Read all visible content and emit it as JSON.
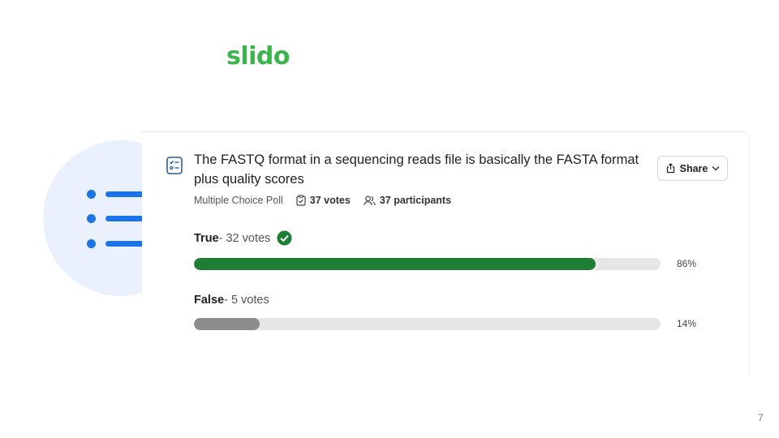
{
  "brand": {
    "logo_text": "slido",
    "color": "#3bb54a"
  },
  "poll": {
    "question": "The FASTQ format in a sequencing reads file is basically the FASTA format plus quality scores",
    "type_label": "Multiple Choice Poll",
    "votes_label": "37 votes",
    "participants_label": "37 participants",
    "share_label": "Share",
    "options": [
      {
        "name": "True",
        "votes_text": " - 32 votes",
        "percent": 86,
        "percent_label": "86%",
        "correct": true,
        "color": "#1e7e34"
      },
      {
        "name": "False",
        "votes_text": " - 5 votes",
        "percent": 14,
        "percent_label": "14%",
        "correct": false,
        "color": "#8c8c8c"
      }
    ]
  },
  "slide": {
    "page_number": "7"
  },
  "colors": {
    "accent_blue": "#1a73e8",
    "deco_bg": "#eaf1fc",
    "track": "#e6e6e6"
  }
}
